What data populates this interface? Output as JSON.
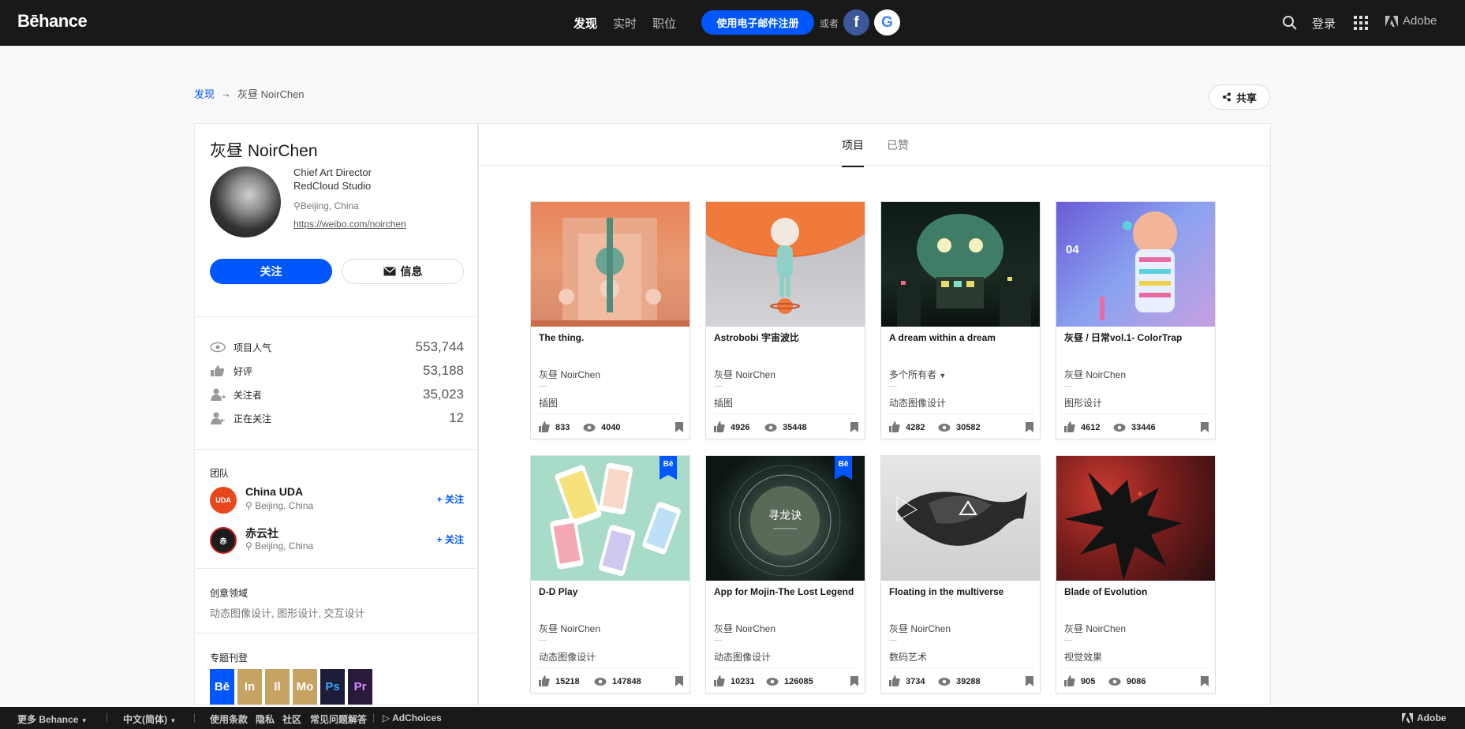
{
  "nav": {
    "logo": "Bēhance",
    "links": [
      "发现",
      "实时",
      "职位"
    ],
    "signup": "使用电子邮件注册",
    "or": "或者",
    "facebook_letter": "f",
    "google_letter": "G",
    "login": "登录",
    "adobe": "Adobe"
  },
  "breadcrumb": {
    "root": "发现",
    "arrow": "→",
    "current": "灰昼 NoirChen"
  },
  "share_label": "共享",
  "profile": {
    "name": "灰昼 NoirChen",
    "role1": "Chief Art Director",
    "role2": "RedCloud Studio",
    "location": "Beijing, China",
    "link": "https://weibo.com/noirchen",
    "follow_label": "关注",
    "message_label": "信息"
  },
  "stats": [
    {
      "label": "项目人气",
      "value": "553,744",
      "icon": "eye-icon"
    },
    {
      "label": "好评",
      "value": "53,188",
      "icon": "thumb-up-icon"
    },
    {
      "label": "关注者",
      "value": "35,023",
      "icon": "followers-icon"
    },
    {
      "label": "正在关注",
      "value": "12",
      "icon": "following-icon"
    }
  ],
  "team": {
    "title": "团队",
    "members": [
      {
        "name": "China UDA",
        "location": "Beijing, China",
        "follow": "+ 关注",
        "avatar_text": "UDA",
        "color": "#e8471c"
      },
      {
        "name": "赤云社",
        "location": "Beijing, China",
        "follow": "+ 关注",
        "avatar_text": "赤",
        "color": "#1c1c1c"
      }
    ]
  },
  "fields": {
    "title": "创意领域",
    "value": "动态图像设计, 图形设计, 交互设计"
  },
  "featured": {
    "title": "专题刊登",
    "badges": [
      {
        "label": "Bē",
        "color": "#0057ff"
      },
      {
        "label": "In",
        "color": "#c6a263"
      },
      {
        "label": "Il",
        "color": "#c6a263"
      },
      {
        "label": "Mo",
        "color": "#c6a263"
      },
      {
        "label": "Ps",
        "color": "#1d1d3a"
      },
      {
        "label": "Pr",
        "color": "#2a1a3a"
      }
    ]
  },
  "tabs": {
    "projects": "项目",
    "appreciated": "已赞"
  },
  "projects": [
    {
      "title": "The thing.",
      "owner": "灰昼 NoirChen",
      "category": "插图",
      "likes": "833",
      "views": "4040"
    },
    {
      "title": "Astrobobi 宇宙波比",
      "owner": "灰昼 NoirChen",
      "category": "插图",
      "likes": "4926",
      "views": "35448"
    },
    {
      "title": "A dream within a dream",
      "owner": "多个所有者",
      "category": "动态图像设计",
      "likes": "4282",
      "views": "30582"
    },
    {
      "title": "灰昼 / 日常vol.1- ColorTrap",
      "owner": "灰昼 NoirChen",
      "category": "图形设计",
      "likes": "4612",
      "views": "33446"
    },
    {
      "title": "D-D Play",
      "owner": "灰昼 NoirChen",
      "category": "动态图像设计",
      "likes": "15218",
      "views": "147848"
    },
    {
      "title": "App for Mojin-The Lost Legend",
      "owner": "灰昼 NoirChen",
      "category": "动态图像设计",
      "likes": "10231",
      "views": "126085"
    },
    {
      "title": "Floating in the multiverse",
      "owner": "灰昼 NoirChen",
      "category": "数码艺术",
      "likes": "3734",
      "views": "39288"
    },
    {
      "title": "Blade of Evolution",
      "owner": "灰昼 NoirChen",
      "category": "视觉效果",
      "likes": "905",
      "views": "9086"
    }
  ],
  "thumb_text": {
    "cover4_number": "04",
    "cover6_text": "寻龙诀",
    "be_badge": "Bē"
  },
  "footer": {
    "more": "更多 Behance",
    "lang": "中文(简体)",
    "terms": "使用条款",
    "privacy": "隐私",
    "community": "社区",
    "faq": "常见问题解答",
    "adchoices": "AdChoices",
    "adobe": "Adobe"
  }
}
